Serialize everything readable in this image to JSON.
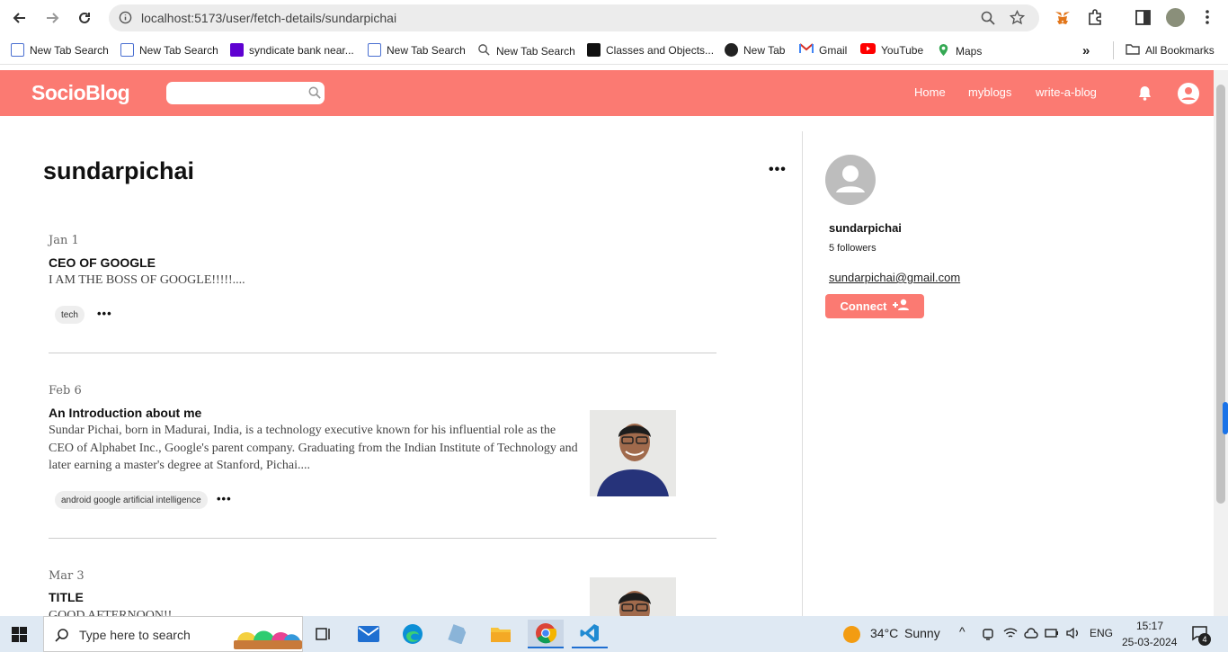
{
  "browser": {
    "url": "localhost:5173/user/fetch-details/sundarpichai",
    "bookmarks": [
      {
        "label": "New Tab Search",
        "icon": "page-icon"
      },
      {
        "label": "New Tab Search",
        "icon": "page-icon"
      },
      {
        "label": "syndicate bank near...",
        "icon": "yahoo-icon"
      },
      {
        "label": "New Tab Search",
        "icon": "page-icon"
      },
      {
        "label": "New Tab Search",
        "icon": "search-icon"
      },
      {
        "label": "Classes and Objects...",
        "icon": "gfg-icon"
      },
      {
        "label": "New Tab",
        "icon": "globe-icon"
      },
      {
        "label": "Gmail",
        "icon": "gmail-icon"
      },
      {
        "label": "YouTube",
        "icon": "youtube-icon"
      },
      {
        "label": "Maps",
        "icon": "maps-icon"
      }
    ],
    "all_bookmarks": "All Bookmarks"
  },
  "app": {
    "logo": "SocioBlog",
    "nav": [
      "Home",
      "myblogs",
      "write-a-blog"
    ],
    "accent": "#fb7a72"
  },
  "main": {
    "username": "sundarpichai",
    "posts": [
      {
        "date": "Jan 1",
        "title": "CEO OF GOOGLE",
        "excerpt": "I AM THE BOSS OF GOOGLE!!!!!....",
        "tag": "tech"
      },
      {
        "date": "Feb 6",
        "title": "An Introduction about me",
        "excerpt": "Sundar Pichai, born in Madurai, India, is a technology executive known for his influential role as the CEO of Alphabet Inc., Google's parent company. Graduating from the Indian Institute of Technology and later earning a master's degree at Stanford, Pichai....",
        "tag": "android google artificial intelligence"
      },
      {
        "date": "Mar 3",
        "title": "TITLE",
        "excerpt": "GOOD AFTERNOON!!"
      }
    ]
  },
  "sidebar": {
    "name": "sundarpichai",
    "followers": "5 followers",
    "email": "sundarpichai@gmail.com",
    "connect_label": "Connect"
  },
  "taskbar": {
    "search_placeholder": "Type here to search",
    "temperature": "34°C",
    "weather": "Sunny",
    "lang": "ENG",
    "time": "15:17",
    "date": "25-03-2024",
    "notifications": "4"
  }
}
